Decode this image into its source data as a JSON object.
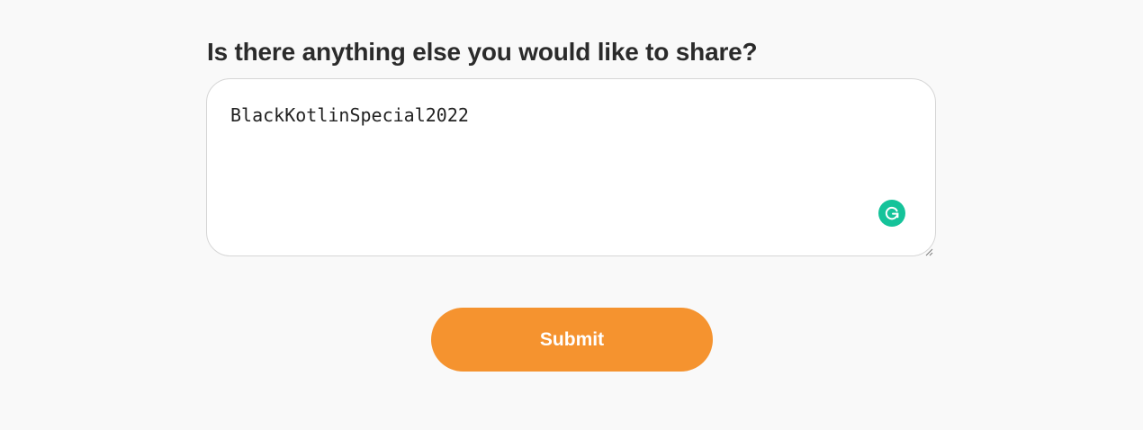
{
  "form": {
    "question": "Is there anything else you would like to share?",
    "textarea_value": "BlackKotlinSpecial2022",
    "submit_label": "Submit"
  },
  "icons": {
    "grammarly": "grammarly-icon",
    "resize": "resize-handle-icon"
  },
  "colors": {
    "background": "#f9f9f9",
    "accent": "#f5932f",
    "grammarly": "#15c39a",
    "text": "#2b2b2b"
  }
}
